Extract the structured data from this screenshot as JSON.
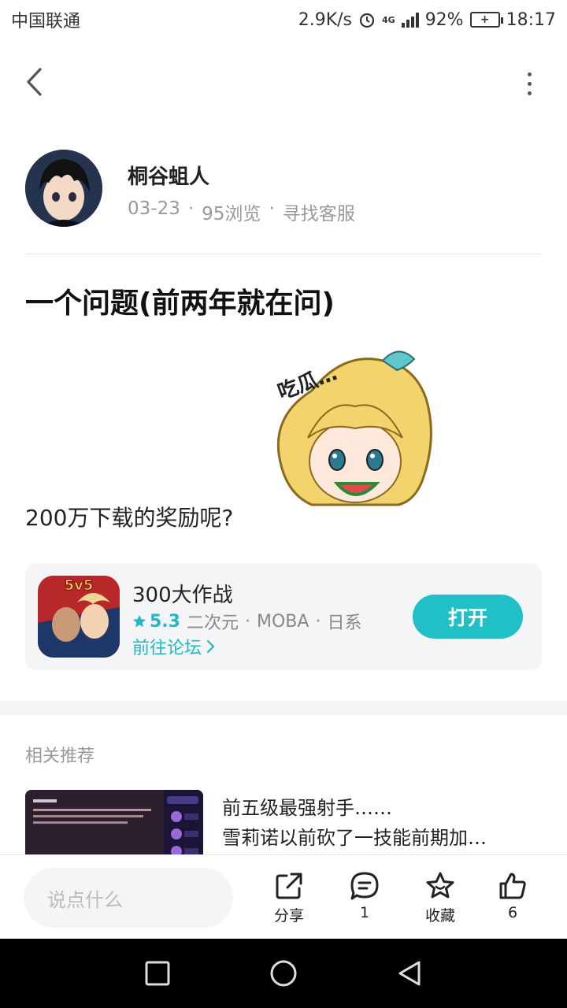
{
  "status_bar": {
    "carrier": "中国联通",
    "speed": "2.9K/s",
    "network": "4G",
    "battery": "92%",
    "time": "18:17"
  },
  "post": {
    "author": "桐谷蛆人",
    "date": "03-23",
    "views": "95浏览",
    "service": "寻找客服",
    "title": "一个问题(前两年就在问)",
    "sticker_text": "吃瓜…",
    "body": "200万下载的奖励呢?"
  },
  "app_card": {
    "name": "300大作战",
    "icon_text": "5v5",
    "rating": "5.3",
    "tags": [
      "二次元",
      "MOBA",
      "日系"
    ],
    "forum_link": "前往论坛",
    "open_label": "打开"
  },
  "related": {
    "title": "相关推荐",
    "item": {
      "line1": "前五级最强射手……",
      "line2": "雪莉诺以前砍了一技能前期加…"
    }
  },
  "bottom_bar": {
    "comment_placeholder": "说点什么",
    "share_label": "分享",
    "comment_count": "1",
    "favorite_label": "收藏",
    "like_count": "6"
  },
  "colors": {
    "accent": "#21c0c6",
    "muted": "#999999"
  }
}
